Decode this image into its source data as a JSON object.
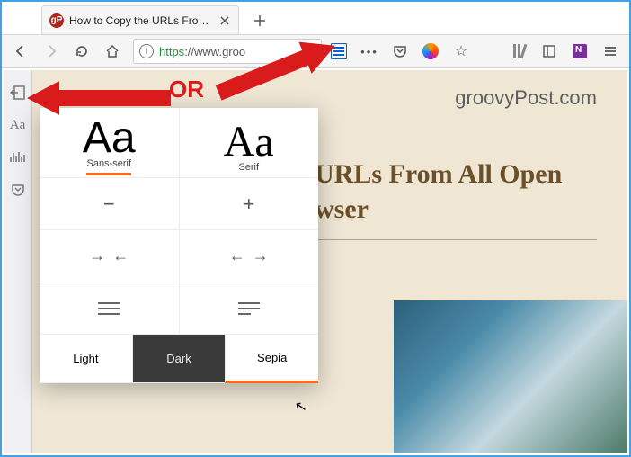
{
  "tab": {
    "favicon_text": "gP",
    "title": "How to Copy the URLs From All …"
  },
  "url": {
    "scheme": "https",
    "rest": "://www.groo"
  },
  "brand": "groovyPost.com",
  "article_title": "URLs From All Open\nwser",
  "annotation": {
    "or_text": "OR"
  },
  "panel": {
    "fonts": {
      "sans": {
        "sample": "Aa",
        "label": "Sans-serif",
        "active": true
      },
      "serif": {
        "sample": "Aa",
        "label": "Serif",
        "active": false
      }
    },
    "size": {
      "decrease": "−",
      "increase": "+"
    },
    "width": {
      "narrower": "→ ←",
      "wider": "← →"
    },
    "themes": {
      "light": "Light",
      "dark": "Dark",
      "sepia": "Sepia"
    }
  }
}
